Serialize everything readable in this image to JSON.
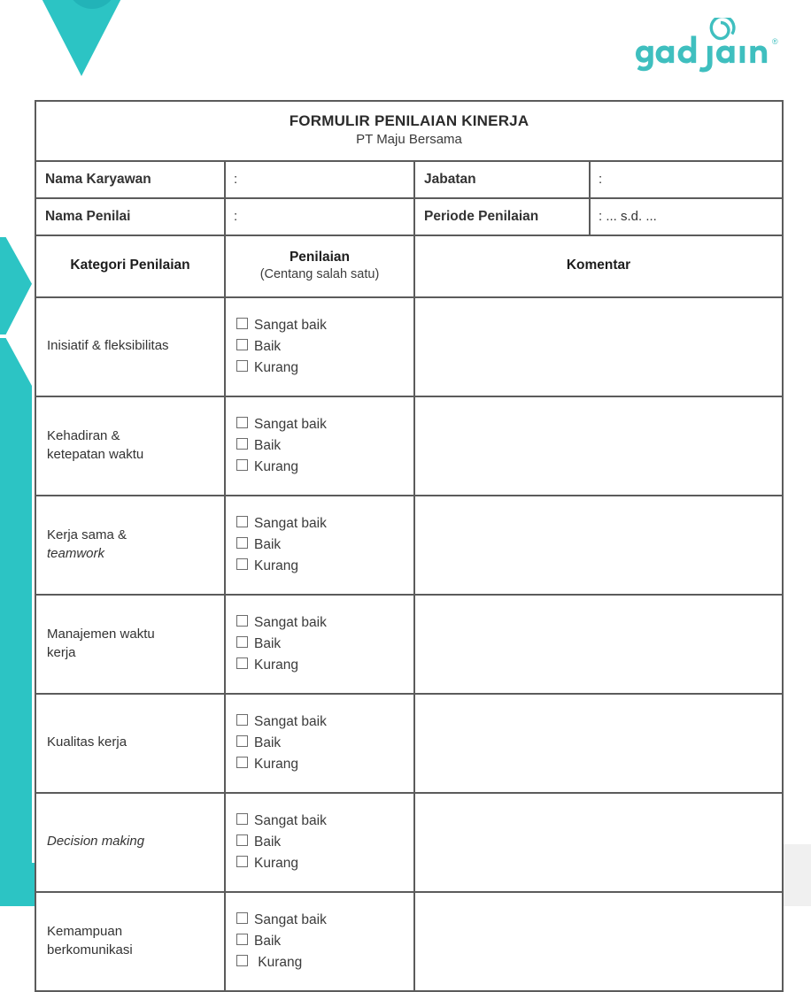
{
  "brand": {
    "logo_text": "gadjian",
    "logo_trademark": "®",
    "teal": "#2cc4c4",
    "logo_color": "#3fbfbf"
  },
  "form": {
    "title": "FORMULIR PENILAIAN KINERJA",
    "company": "PT Maju Bersama",
    "identity": [
      {
        "label": "Nama Karyawan",
        "value": ":",
        "label2": "Jabatan",
        "value2": ":"
      },
      {
        "label": "Nama Penilai",
        "value": ":",
        "label2": "Periode Penilaian",
        "value2": ": ... s.d. ..."
      }
    ],
    "columns": {
      "category": "Kategori Penilaian",
      "rating_main": "Penilaian",
      "rating_sub": "(Centang salah satu)",
      "comment": "Komentar"
    },
    "options": [
      "Sangat baik",
      "Baik",
      "Kurang"
    ],
    "options_last": [
      "Sangat baik",
      "Baik",
      " Kurang"
    ],
    "rows": [
      {
        "category": "Inisiatif & fleksibilitas",
        "category_line2": "",
        "italic_line2": false,
        "italic": false,
        "comment": ""
      },
      {
        "category": "Kehadiran &",
        "category_line2": "ketepatan waktu",
        "italic_line2": false,
        "italic": false,
        "comment": ""
      },
      {
        "category": "Kerja sama &",
        "category_line2": "teamwork",
        "italic_line2": true,
        "italic": false,
        "comment": ""
      },
      {
        "category": "Manajemen waktu",
        "category_line2": "kerja",
        "italic_line2": false,
        "italic": false,
        "comment": ""
      },
      {
        "category": "Kualitas kerja",
        "category_line2": "",
        "italic_line2": false,
        "italic": false,
        "comment": ""
      },
      {
        "category": "Decision making",
        "category_line2": "",
        "italic_line2": false,
        "italic": true,
        "comment": ""
      },
      {
        "category": "Kemampuan",
        "category_line2": "berkomunikasi",
        "italic_line2": false,
        "italic": false,
        "comment": ""
      }
    ]
  }
}
